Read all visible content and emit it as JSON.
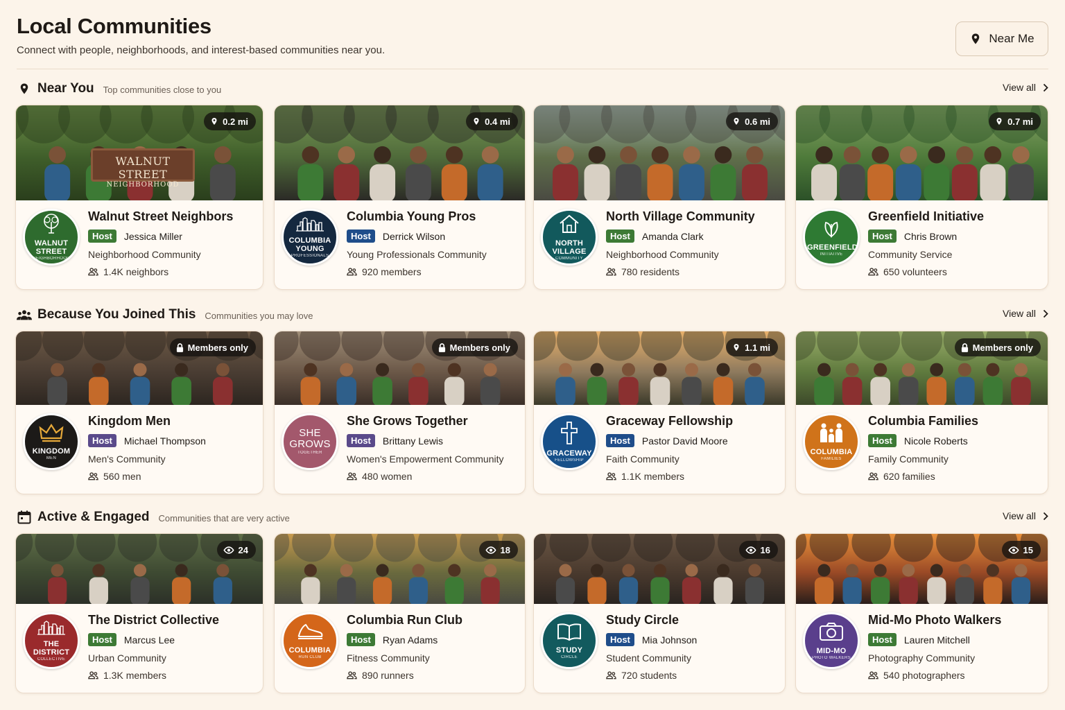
{
  "header": {
    "title": "Local Communities",
    "subtitle": "Connect with people, neighborhoods, and interest-based communities near you.",
    "near_me_label": "Near Me"
  },
  "sections": [
    {
      "title": "Near You",
      "subtitle": "Top communities close to you",
      "view_all": "View all",
      "icon": "map-pin-icon"
    },
    {
      "title": "Because You Joined This",
      "subtitle": "Communities you may love",
      "view_all": "View all",
      "icon": "people-group-icon"
    },
    {
      "title": "Active & Engaged",
      "subtitle": "Communities that are very active",
      "view_all": "View all",
      "icon": "calendar-icon"
    }
  ],
  "host_label": "Host",
  "cards": [
    {
      "name": "Walnut Street Neighbors",
      "host": "Jessica Miller",
      "type": "Neighborhood Community",
      "count": "1.4K neighbors",
      "badge": "0.2 mi",
      "badge_icon": "pin",
      "logo_line1": "WALNUT STREET",
      "logo_line2": "NEIGHBORHOOD",
      "logo_icon": "tree-icon",
      "logo_color": "#2e6b2e",
      "host_color": "#3d7a35",
      "photo_sign_line1": "WALNUT STREET",
      "photo_sign_line2": "NEIGHBORHOOD"
    },
    {
      "name": "Columbia Young Pros",
      "host": "Derrick Wilson",
      "type": "Young Professionals Community",
      "count": "920 members",
      "badge": "0.4 mi",
      "badge_icon": "pin",
      "logo_line1": "COLUMBIA YOUNG",
      "logo_line2": "PROFESSIONALS",
      "logo_icon": "skyline-icon",
      "logo_color": "#14283f",
      "host_color": "#1f4d8a"
    },
    {
      "name": "North Village Community",
      "host": "Amanda Clark",
      "type": "Neighborhood Community",
      "count": "780 residents",
      "badge": "0.6 mi",
      "badge_icon": "pin",
      "logo_line1": "NORTH VILLAGE",
      "logo_line2": "COMMUNITY",
      "logo_icon": "house-icon",
      "logo_color": "#12595c",
      "host_color": "#3d7a35"
    },
    {
      "name": "Greenfield Initiative",
      "host": "Chris Brown",
      "type": "Community Service",
      "count": "650 volunteers",
      "badge": "0.7 mi",
      "badge_icon": "pin",
      "logo_line1": "GREENFIELD",
      "logo_line2": "INITIATIVE",
      "logo_icon": "leaf-icon",
      "logo_color": "#2e7a33",
      "host_color": "#3d7a35"
    },
    {
      "name": "Kingdom Men",
      "host": "Michael Thompson",
      "type": "Men's Community",
      "count": "560 men",
      "badge": "Members only",
      "badge_icon": "lock",
      "logo_line1": "KINGDOM",
      "logo_line2": "MEN",
      "logo_icon": "crown-icon",
      "logo_color": "#1c1a18",
      "host_color": "#5a4a8a"
    },
    {
      "name": "She Grows Together",
      "host": "Brittany Lewis",
      "type": "Women's Empowerment Community",
      "count": "480 women",
      "badge": "Members only",
      "badge_icon": "lock",
      "logo_line1": "SHE GROWS",
      "logo_line2": "TOGETHER",
      "logo_icon": "none",
      "logo_color": "#a3586c",
      "host_color": "#5a4a8a"
    },
    {
      "name": "Graceway Fellowship",
      "host": "Pastor David Moore",
      "type": "Faith Community",
      "count": "1.1K members",
      "badge": "1.1 mi",
      "badge_icon": "pin",
      "logo_line1": "GRACEWAY",
      "logo_line2": "FELLOWSHIP",
      "logo_icon": "cross-icon",
      "logo_color": "#175089",
      "host_color": "#1f4d8a"
    },
    {
      "name": "Columbia Families",
      "host": "Nicole Roberts",
      "type": "Family Community",
      "count": "620 families",
      "badge": "Members only",
      "badge_icon": "lock",
      "logo_line1": "COLUMBIA",
      "logo_line2": "FAMILIES",
      "logo_icon": "family-icon",
      "logo_color": "#d0731a",
      "host_color": "#3d7a35"
    },
    {
      "name": "The District Collective",
      "host": "Marcus Lee",
      "type": "Urban Community",
      "count": "1.3K members",
      "badge": "24",
      "badge_icon": "eye",
      "logo_line1": "THE DISTRICT",
      "logo_line2": "COLLECTIVE",
      "logo_icon": "skyline-icon",
      "logo_color": "#9a2a2c",
      "host_color": "#3d7a35"
    },
    {
      "name": "Columbia Run Club",
      "host": "Ryan Adams",
      "type": "Fitness Community",
      "count": "890 runners",
      "badge": "18",
      "badge_icon": "eye",
      "logo_line1": "COLUMBIA",
      "logo_line2": "RUN CLUB",
      "logo_icon": "shoe-icon",
      "logo_color": "#d4661a",
      "host_color": "#3d7a35"
    },
    {
      "name": "Study Circle",
      "host": "Mia Johnson",
      "type": "Student Community",
      "count": "720 students",
      "badge": "16",
      "badge_icon": "eye",
      "logo_line1": "STUDY",
      "logo_line2": "CIRCLE",
      "logo_icon": "book-icon",
      "logo_color": "#125a5e",
      "host_color": "#1f4d8a"
    },
    {
      "name": "Mid-Mo Photo Walkers",
      "host": "Lauren Mitchell",
      "type": "Photography Community",
      "count": "540 photographers",
      "badge": "15",
      "badge_icon": "eye",
      "logo_line1": "MID-MO",
      "logo_line2": "PHOTO WALKERS",
      "logo_icon": "camera-icon",
      "logo_color": "#5a3f8c",
      "host_color": "#3d7a35"
    }
  ]
}
